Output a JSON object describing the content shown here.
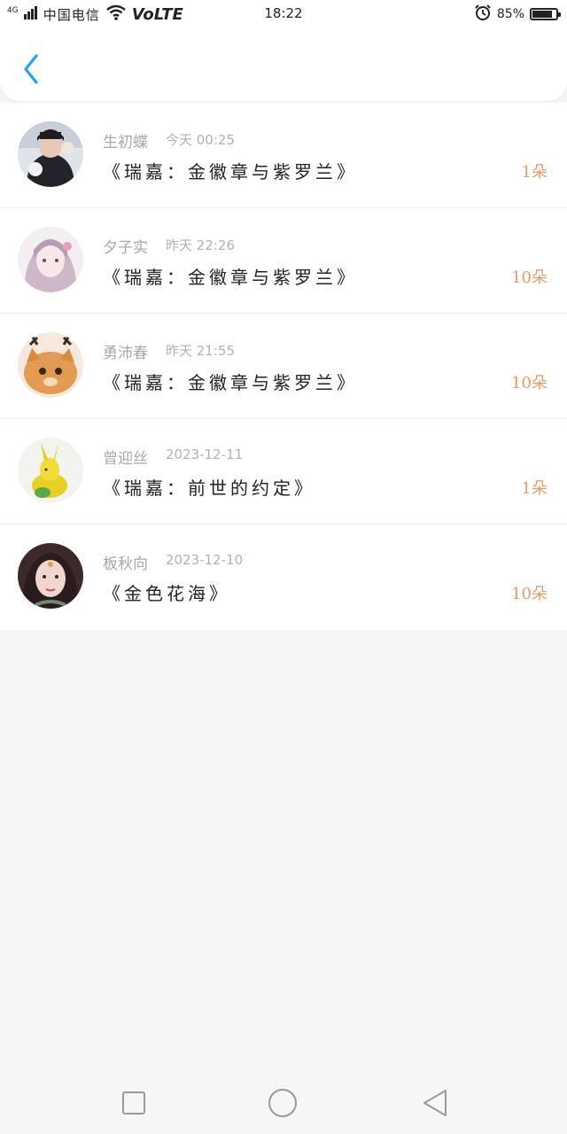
{
  "status_bar": {
    "network": "4G",
    "carrier": "中国电信",
    "volte": "VoLTE",
    "time": "18:22",
    "battery_text": "85%",
    "battery_level": 0.85
  },
  "header": {
    "back_icon": "chevron-left-icon",
    "accent_color": "#2b9ff0"
  },
  "items": [
    {
      "name": "生初蝶",
      "time": "今天 00:25",
      "title": "《瑞嘉：金徽章与紫罗兰》",
      "qty": "1朵"
    },
    {
      "name": "夕子实",
      "time": "昨天 22:26",
      "title": "《瑞嘉：金徽章与紫罗兰》",
      "qty": "10朵"
    },
    {
      "name": "勇沛春",
      "time": "昨天 21:55",
      "title": "《瑞嘉：金徽章与紫罗兰》",
      "qty": "10朵"
    },
    {
      "name": "曾迎丝",
      "time": "2023-12-11",
      "title": "《瑞嘉：前世的约定》",
      "qty": "1朵"
    },
    {
      "name": "板秋向",
      "time": "2023-12-10",
      "title": "《金色花海》",
      "qty": "10朵"
    }
  ],
  "nav": {
    "recent_icon": "square-icon",
    "home_icon": "circle-icon",
    "back_icon": "triangle-back-icon"
  },
  "colors": {
    "qty": "#e89a66",
    "background": "#f7f5f5"
  }
}
